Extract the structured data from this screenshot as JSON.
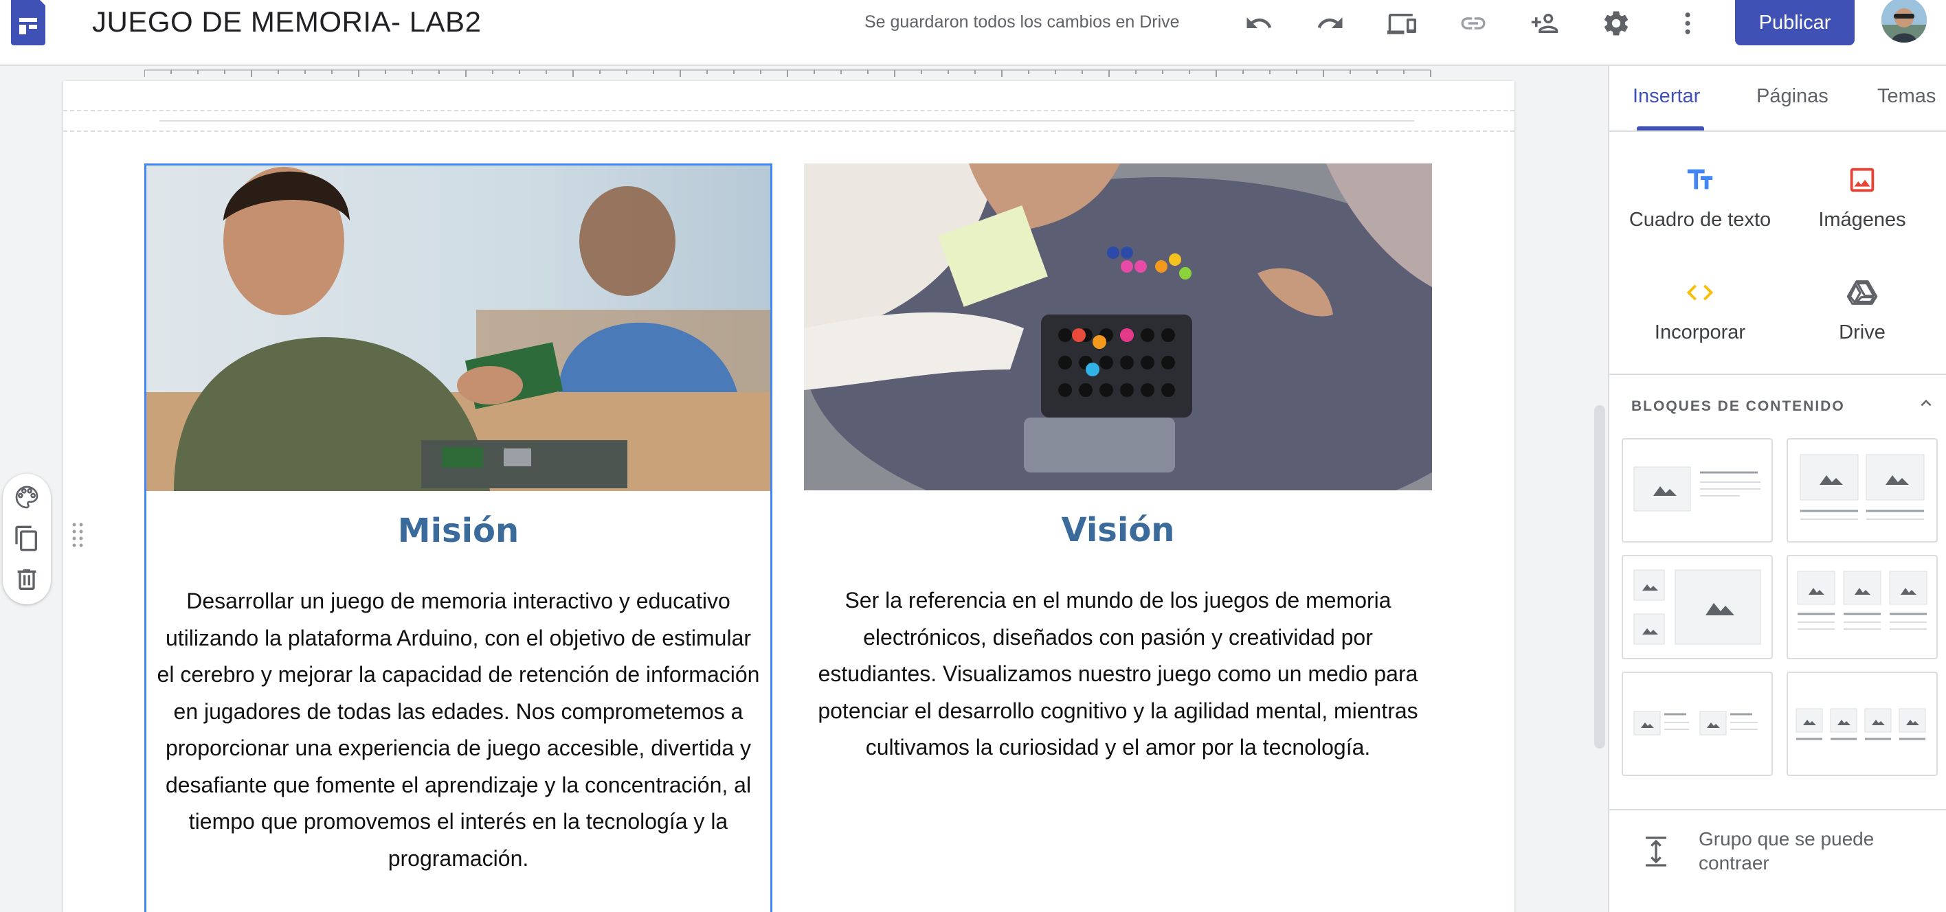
{
  "header": {
    "title": "JUEGO DE MEMORIA- LAB2",
    "save_status": "Se guardaron todos los cambios en Drive",
    "publish_label": "Publicar",
    "icons": [
      "undo-icon",
      "redo-icon",
      "preview-devices-icon",
      "link-icon",
      "share-add-person-icon",
      "settings-gear-icon",
      "more-vert-icon"
    ]
  },
  "content": {
    "left": {
      "heading": "Misión",
      "body": "Desarrollar un juego de memoria interactivo y educativo utilizando la plataforma Arduino, con el objetivo de estimular el cerebro y mejorar la capacidad de retención de información en jugadores de todas las edades. Nos comprometemos a proporcionar una experiencia de juego accesible, divertida y desafiante que fomente el aprendizaje y la concentración, al tiempo que promovemos el interés en la tecnología y la programación."
    },
    "right": {
      "heading": "Visión",
      "body": "Ser la referencia en el mundo de los juegos de memoria electrónicos, diseñados con pasión y creatividad por estudiantes. Visualizamos nuestro juego como un medio para potenciar el desarrollo cognitivo y la agilidad mental, mientras cultivamos la curiosidad y el amor por la tecnología."
    }
  },
  "panel": {
    "tabs": [
      {
        "label": "Insertar",
        "active": true
      },
      {
        "label": "Páginas",
        "active": false
      },
      {
        "label": "Temas",
        "active": false
      }
    ],
    "insert_items": [
      {
        "label": "Cuadro de texto",
        "icon": "text-box-icon"
      },
      {
        "label": "Imágenes",
        "icon": "image-icon"
      },
      {
        "label": "Incorporar",
        "icon": "embed-code-icon"
      },
      {
        "label": "Drive",
        "icon": "drive-icon"
      }
    ],
    "blocks_title": "BLOQUES DE CONTENIDO",
    "collapsible_label": "Grupo que se puede contraer"
  },
  "colors": {
    "accent": "#3f51b5",
    "heading": "#3a6b9a",
    "selection": "#4285f4",
    "text_box_icon": "#4285f4",
    "image_icon": "#ea4335",
    "embed_icon": "#fbbc04"
  }
}
